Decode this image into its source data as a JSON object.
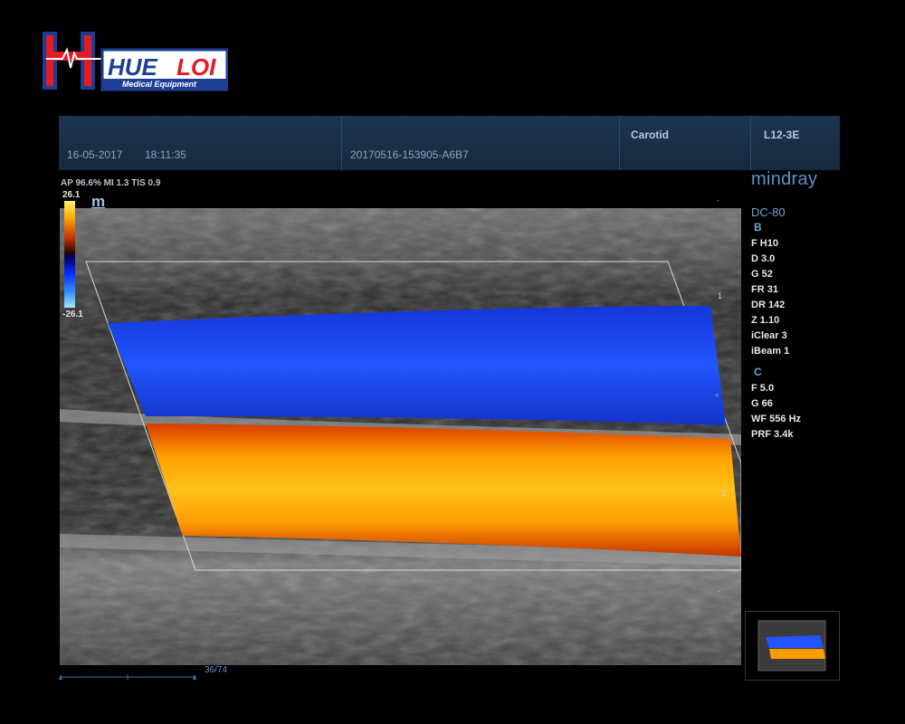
{
  "logo": {
    "text_main_1": "HUE",
    "text_main_2": "LOI",
    "subtitle": "Medical Equipment",
    "colors": {
      "red": "#e41b23",
      "blue": "#1d3f93"
    }
  },
  "header": {
    "date": "16-05-2017",
    "time": "18:11:35",
    "study_id": "20170516-153905-A6B7",
    "exam": "Carotid",
    "probe": "L12-3E"
  },
  "image_info": {
    "safety": "AP 96.6%  MI 1.3  TIS 0.9",
    "scale_max": "26.1",
    "scale_min": "-26.1",
    "mode_icon": "m"
  },
  "right_panel": {
    "brand": "mindray",
    "model": "DC-80",
    "b_mode": {
      "label": "B",
      "params": [
        "F H10",
        "D 3.0",
        "G 52",
        "FR 31",
        "DR 142",
        "Z 1.10",
        "iClear 3",
        "iBeam 1"
      ]
    },
    "c_mode": {
      "label": "C",
      "params": [
        "F 5.0",
        "G 66",
        "WF 556 Hz",
        "PRF 3.4k"
      ]
    }
  },
  "depth_marks": [
    "1",
    "2"
  ],
  "cine": {
    "frame_count": "36/74"
  },
  "colors": {
    "header_bg": "#1b3048",
    "text_blue": "#6fa1cf",
    "flow_blue": "#1d47f0",
    "flow_orange": "#ff9c00"
  }
}
